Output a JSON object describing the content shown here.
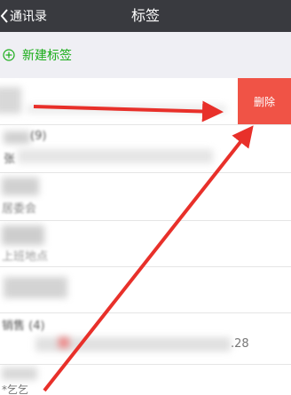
{
  "header": {
    "back_label": "通讯录",
    "title": "标签"
  },
  "new_tag": {
    "label": "新建标签"
  },
  "swiped_row": {
    "action_label": "删除"
  },
  "rows": [
    {
      "visible_fragment": ""
    },
    {
      "visible_fragment": "(9)",
      "sub_fragment": "张"
    },
    {
      "visible_fragment": "",
      "sub_fragment": "居委会"
    },
    {
      "visible_fragment": "",
      "sub_fragment": "上班地点"
    },
    {
      "visible_fragment": ""
    },
    {
      "visible_fragment": "销售 (4)",
      "sub_fragment": ".28"
    },
    {
      "visible_fragment": "",
      "sub_fragment": "*乞乞"
    }
  ],
  "colors": {
    "nav_bg": "#393a3f",
    "accent_green": "#1aad19",
    "delete_red": "#f05346",
    "arrow_red": "#e8302a"
  }
}
